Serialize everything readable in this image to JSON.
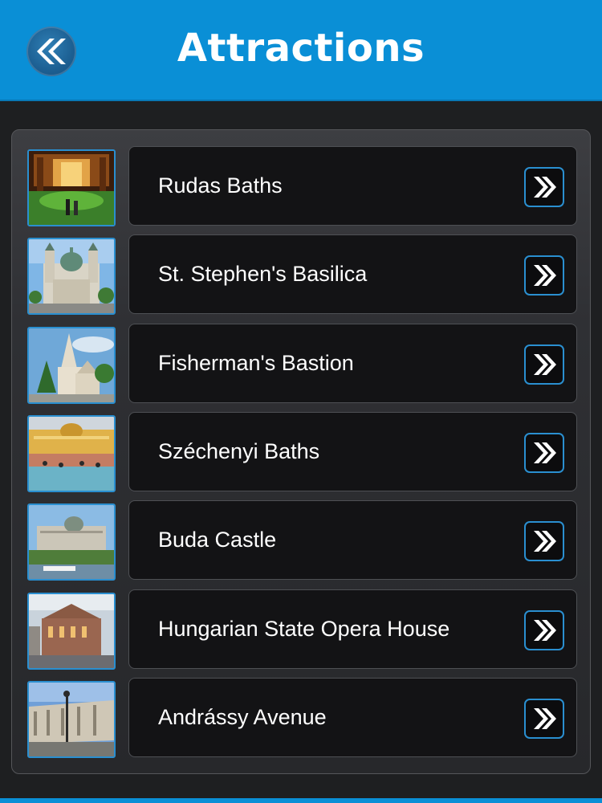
{
  "header": {
    "title": "Attractions",
    "back_icon": "double-chevron-left-icon",
    "background_color": "#0a8fd6"
  },
  "list": {
    "item_arrow_icon": "double-chevron-right-icon",
    "accent_color": "#2a8fd0",
    "items": [
      {
        "label": "Rudas Baths",
        "thumbnail": "rudas-baths-photo"
      },
      {
        "label": "St. Stephen's Basilica",
        "thumbnail": "st-stephens-basilica-photo"
      },
      {
        "label": "Fisherman's Bastion",
        "thumbnail": "fishermans-bastion-photo"
      },
      {
        "label": "Széchenyi Baths",
        "thumbnail": "szechenyi-baths-photo"
      },
      {
        "label": "Buda Castle",
        "thumbnail": "buda-castle-photo"
      },
      {
        "label": "Hungarian State Opera House",
        "thumbnail": "opera-house-photo"
      },
      {
        "label": "Andrássy Avenue",
        "thumbnail": "andrassy-avenue-photo"
      }
    ]
  }
}
